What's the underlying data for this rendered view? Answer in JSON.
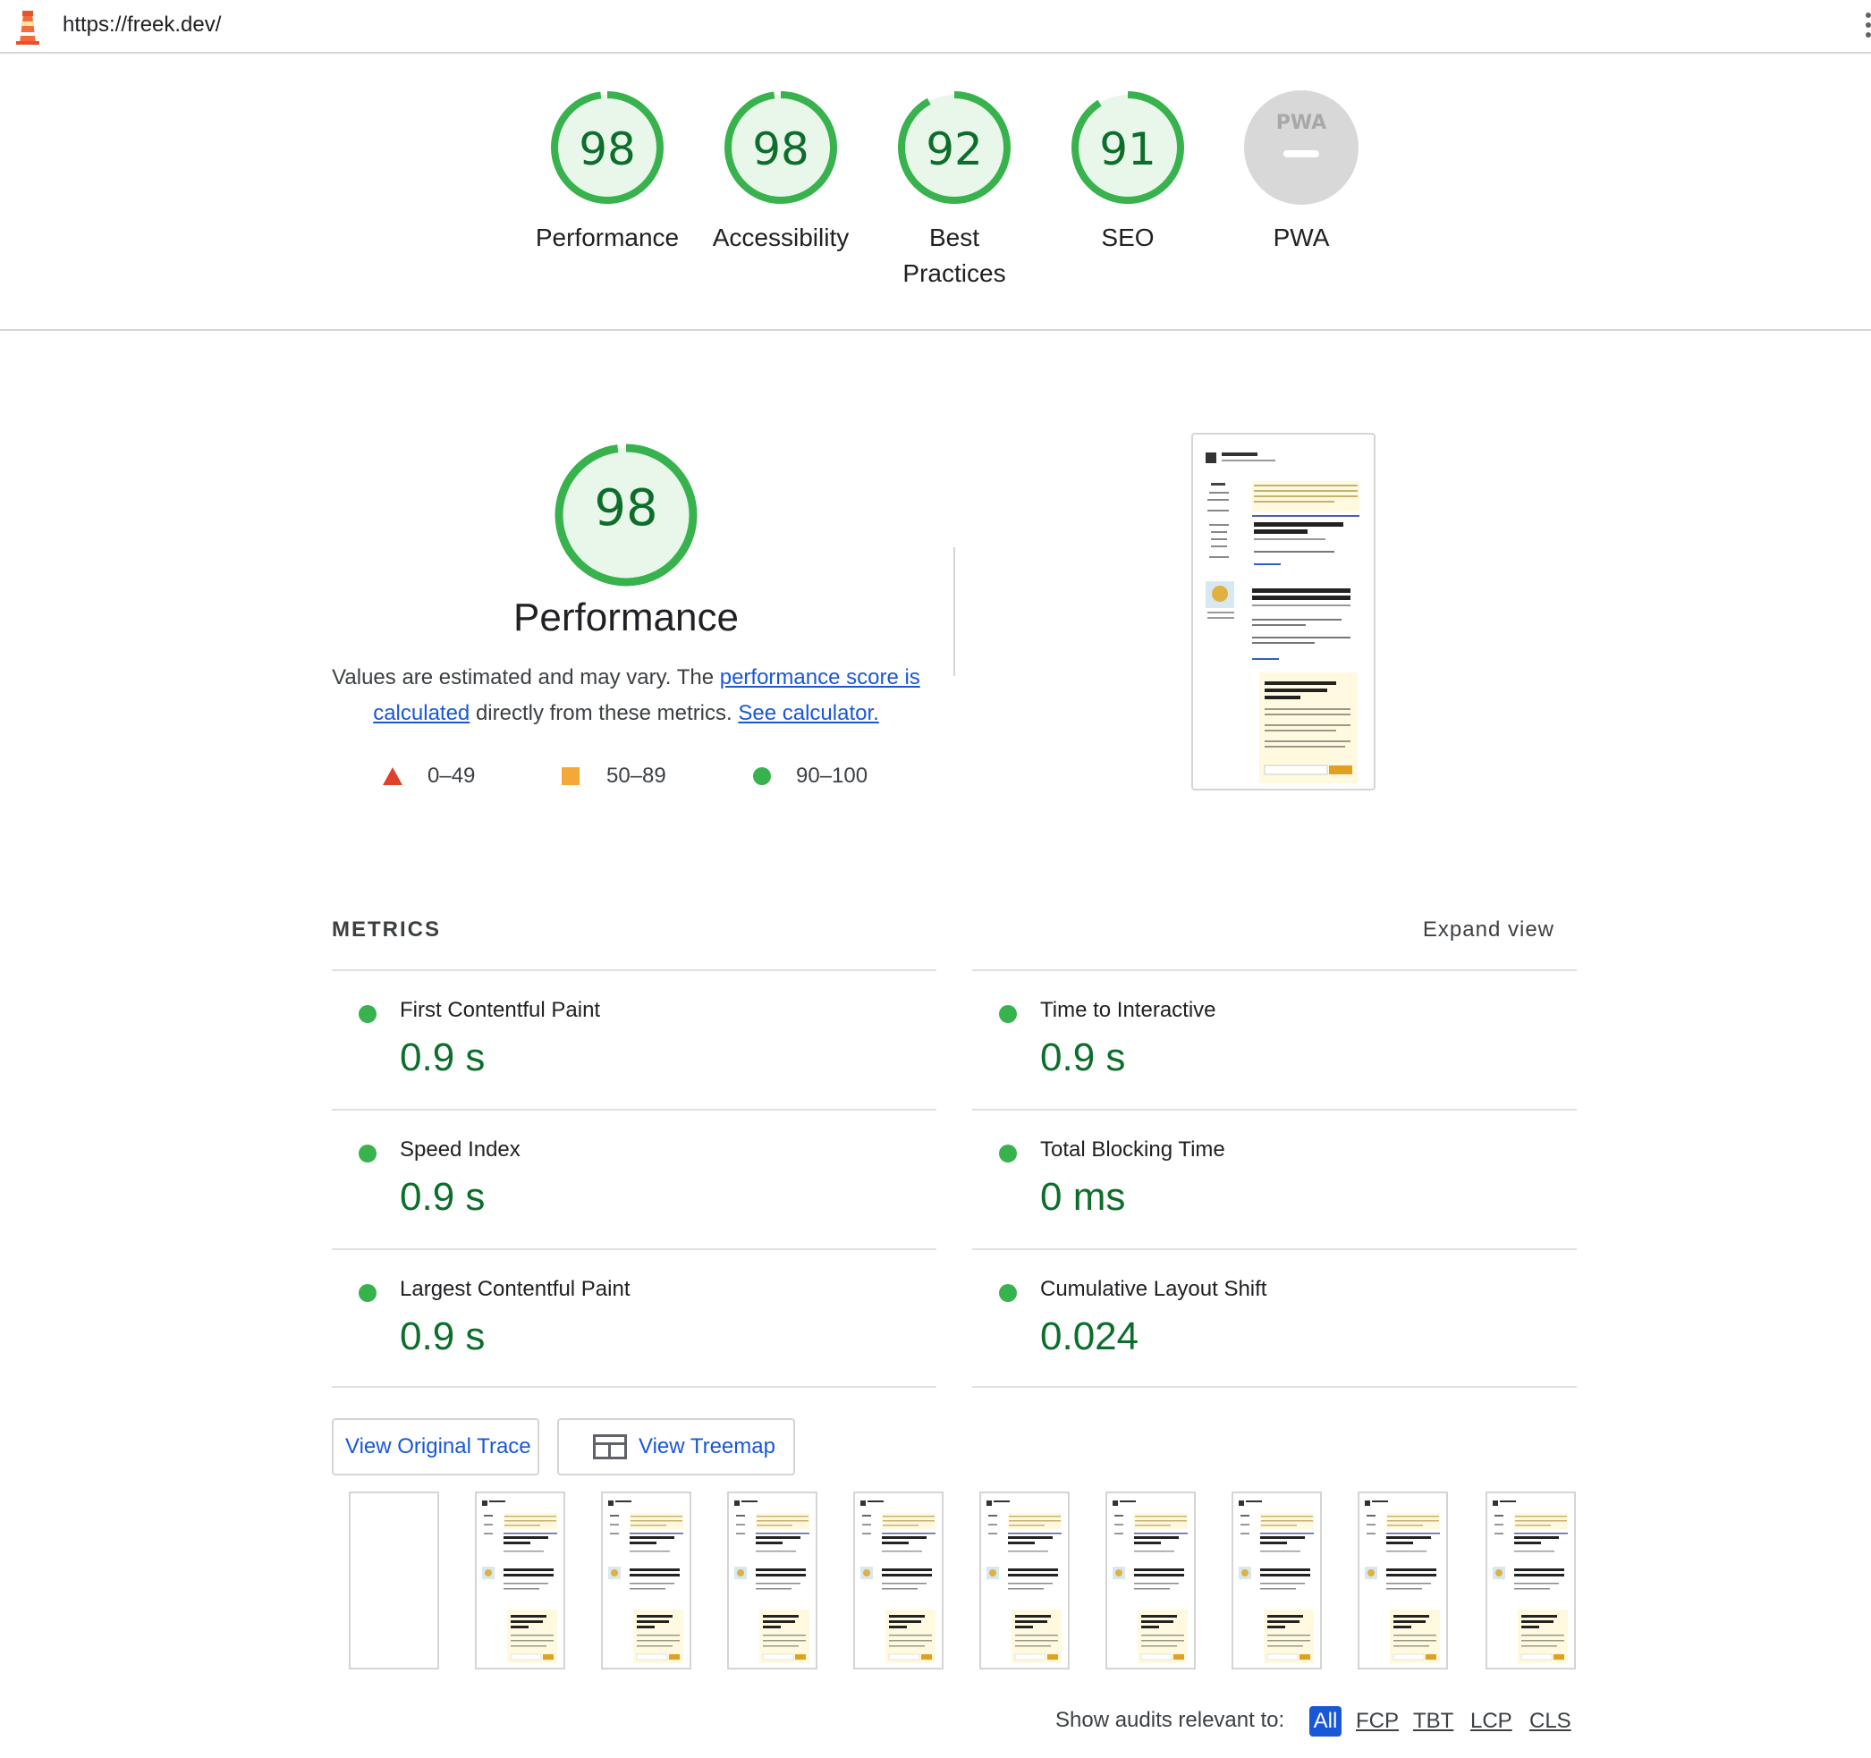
{
  "topbar": {
    "url": "https://freek.dev/"
  },
  "colors": {
    "pass": "#0c6e2a",
    "pass_ring": "#37b24d",
    "pass_fill": "#e8f7ea",
    "link": "#1a57d6",
    "average": "#f4a836",
    "fail": "#e0412d",
    "na": "#d8d8d8"
  },
  "gauges": [
    {
      "score": "98",
      "label": "Performance",
      "value": 98
    },
    {
      "score": "98",
      "label": "Accessibility",
      "value": 98
    },
    {
      "score": "92",
      "label": "Best Practices",
      "value": 92
    },
    {
      "score": "91",
      "label": "SEO",
      "value": 91
    },
    {
      "score": "PWA",
      "label": "PWA",
      "value": null
    }
  ],
  "performance": {
    "score": "98",
    "value": 98,
    "title": "Performance",
    "desc_prefix": "Values are estimated and may vary. The ",
    "desc_link1": "performance score is calculated",
    "desc_middle": " directly from these metrics.",
    "desc_link2": "See calculator.",
    "legend": [
      "0–49",
      "50–89",
      "90–100"
    ]
  },
  "metrics": {
    "heading": "METRICS",
    "expand_label": "Expand view",
    "items": [
      {
        "name": "First Contentful Paint",
        "value": "0.9 s"
      },
      {
        "name": "Time to Interactive",
        "value": "0.9 s"
      },
      {
        "name": "Speed Index",
        "value": "0.9 s"
      },
      {
        "name": "Total Blocking Time",
        "value": "0 ms"
      },
      {
        "name": "Largest Contentful Paint",
        "value": "0.9 s"
      },
      {
        "name": "Cumulative Layout Shift",
        "value": "0.024"
      }
    ]
  },
  "buttons": {
    "trace": "View Original Trace",
    "treemap": "View Treemap"
  },
  "filmstrip": {
    "frames": 10
  },
  "audit_filter": {
    "label": "Show audits relevant to:",
    "options": [
      "All",
      "FCP",
      "TBT",
      "LCP",
      "CLS"
    ],
    "active": "All"
  }
}
